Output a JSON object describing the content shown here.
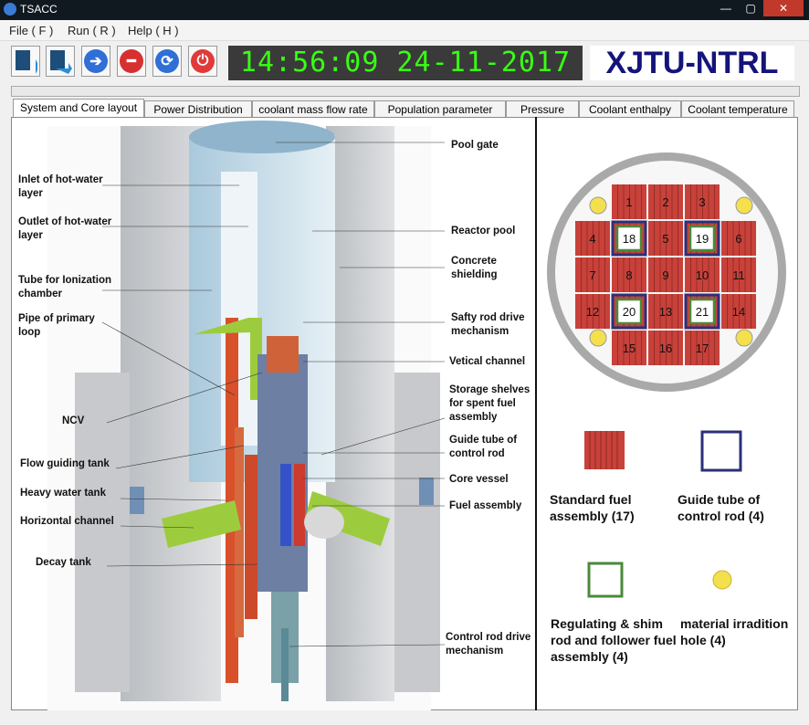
{
  "window": {
    "title": "TSACC",
    "controls": [
      "—",
      "▢",
      "✕"
    ]
  },
  "menu": [
    "File ( F )",
    "Run ( R )",
    "Help ( H )"
  ],
  "toolbar": {
    "clock": "14:56:09 24-11-2017",
    "brand": "XJTU-NTRL"
  },
  "tabs": [
    "System and Core layout",
    "Power Distribution",
    "coolant mass flow rate",
    "Population parameter",
    "Pressure",
    "Coolant enthalpy",
    "Coolant temperature"
  ],
  "labels_left": {
    "inlet": "Inlet of hot-water layer",
    "outlet": "Outlet of hot-water layer",
    "tube": "Tube for Ionization chamber",
    "pipe": "Pipe of primary loop",
    "ncv": "NCV",
    "flow": "Flow guiding tank",
    "heavy": "Heavy water tank",
    "horizontal": "Horizontal channel",
    "decay": "Decay tank"
  },
  "labels_right": {
    "pool_gate": "Pool gate",
    "reactor_pool": "Reactor pool",
    "concrete": "Concrete shielding",
    "safety": "Safty rod drive mechanism",
    "vertical": "Vetical channel",
    "storage": "Storage shelves for spent fuel assembly",
    "guide": "Guide tube of control rod",
    "core_vessel": "Core vessel",
    "fuel": "Fuel assembly",
    "crdm": "Control rod drive mechanism"
  },
  "core_cells": [
    "1",
    "2",
    "3",
    "4",
    "18",
    "5",
    "19",
    "6",
    "7",
    "8",
    "9",
    "10",
    "11",
    "12",
    "20",
    "13",
    "21",
    "14",
    "15",
    "16",
    "17"
  ],
  "legend": {
    "standard": "Standard fuel assembly (17)",
    "guide": "Guide tube of control rod (4)",
    "regulating": "Regulating & shim rod and follower fuel assembly (4)",
    "hole": "material irradition hole (4)"
  },
  "colors": {
    "fuel": "#c8413a",
    "guide": "#2b2f7a",
    "regulating": "#4a8a3a",
    "hole": "#f4e04d",
    "clock": "#39ff14",
    "brand": "#14147a"
  }
}
